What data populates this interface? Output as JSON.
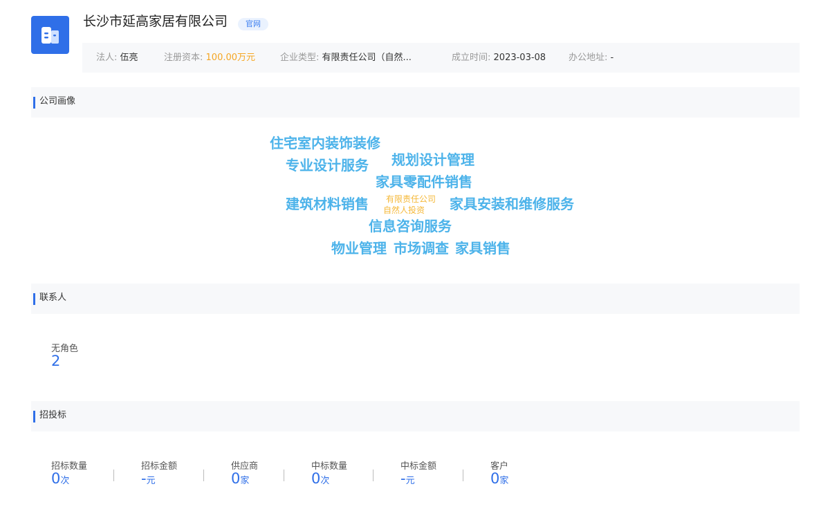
{
  "company": {
    "name": "长沙市延高家居有限公司",
    "badge": "官网"
  },
  "info": {
    "legal_rep_label": "法人:",
    "legal_rep_value": "伍亮",
    "capital_label": "注册资本:",
    "capital_value": "100.00万元",
    "type_label": "企业类型:",
    "type_value": "有限责任公司（自然...",
    "founded_label": "成立时间:",
    "founded_value": "2023-03-08",
    "address_label": "办公地址:",
    "address_value": "-"
  },
  "portrait": {
    "title": "公司画像",
    "tags": [
      "住宅室内装饰装修",
      "专业设计服务",
      "规划设计管理",
      "家具零配件销售",
      "建筑材料销售",
      "有限责任公司",
      "自然人投资",
      "家具安装和维修服务",
      "信息咨询服务",
      "物业管理",
      "市场调查",
      "家具销售"
    ]
  },
  "contacts": {
    "title": "联系人",
    "role_label": "无角色",
    "role_count": "2"
  },
  "bidding": {
    "title": "招投标",
    "stats": [
      {
        "label": "招标数量",
        "value": "0",
        "unit": "次"
      },
      {
        "label": "招标金额",
        "value": "-",
        "unit": "元"
      },
      {
        "label": "供应商",
        "value": "0",
        "unit": "家"
      },
      {
        "label": "中标数量",
        "value": "0",
        "unit": "次"
      },
      {
        "label": "中标金额",
        "value": "-",
        "unit": "元"
      },
      {
        "label": "客户",
        "value": "0",
        "unit": "家"
      }
    ]
  },
  "colors": {
    "accent": "#2f6fe8",
    "tag_blue": "#4db3ea",
    "tag_yellow": "#f5b838",
    "capital_orange": "#f5a623"
  }
}
